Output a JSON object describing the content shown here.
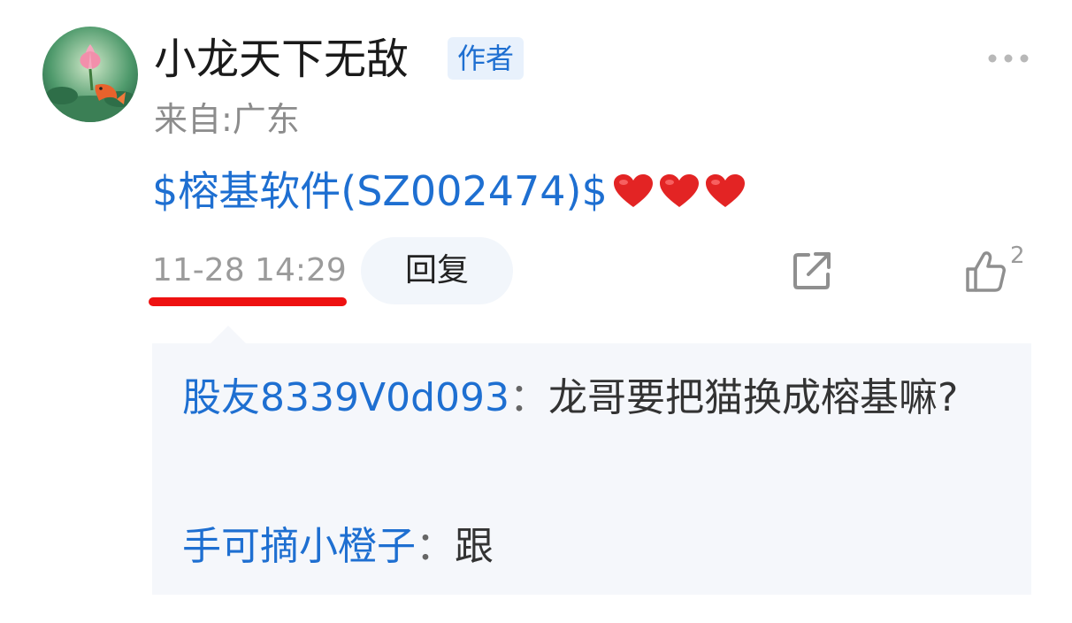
{
  "post": {
    "username": "小龙天下无敌",
    "author_badge": "作者",
    "location": "来自:广东",
    "stock_link": "$榕基软件(SZ002474)$",
    "timestamp": "11-28 14:29",
    "reply_label": "回复",
    "like_count": "2"
  },
  "replies": [
    {
      "author": "股友8339V0d093",
      "separator": "：",
      "text": "龙哥要把猫换成榕基嘛?"
    },
    {
      "author": "手可摘小橙子",
      "separator": "：",
      "text": "跟"
    }
  ],
  "icons": {
    "more": "more-dots-icon",
    "share": "share-icon",
    "like": "thumbs-up-icon",
    "heart": "red-heart-emoji"
  },
  "colors": {
    "link_blue": "#1e6fd1",
    "badge_bg": "#e8f1fc",
    "underline_red": "#ee1111",
    "heart_red": "#e32424",
    "reply_bg": "#f5f7fb",
    "muted_gray": "#9b9b9b"
  }
}
